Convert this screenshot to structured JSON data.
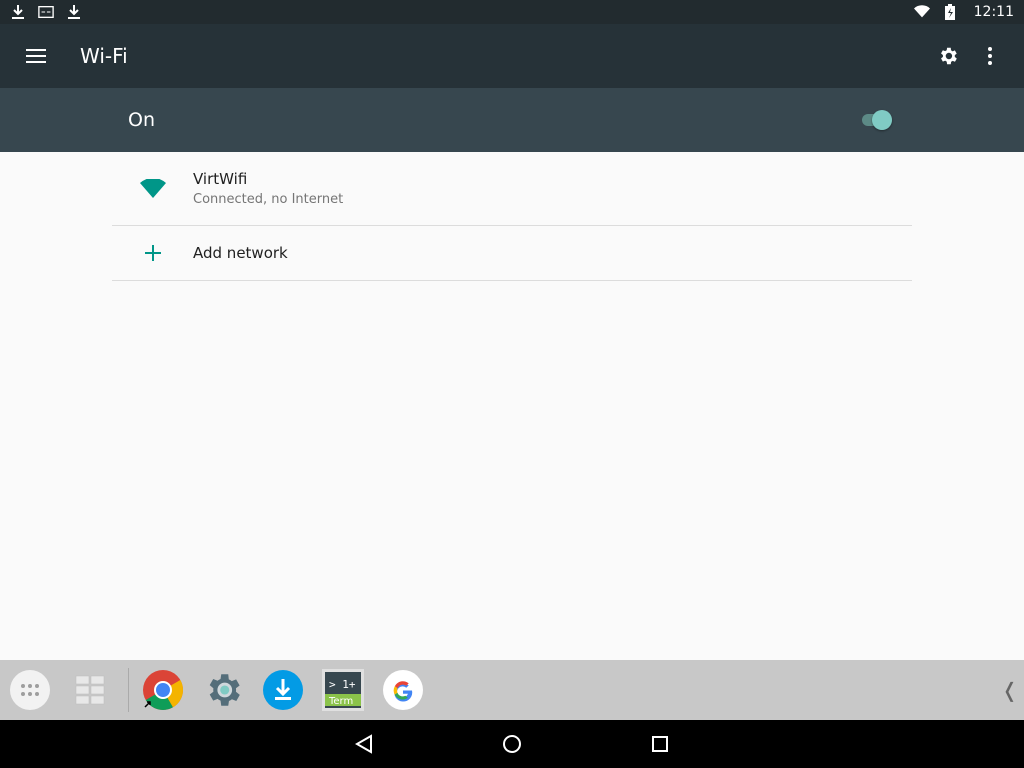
{
  "status_bar": {
    "time": "12:11",
    "left_icons": [
      "download-icon",
      "sim-icon",
      "download-icon"
    ],
    "right_icons": [
      "wifi-icon",
      "battery-icon"
    ]
  },
  "toolbar": {
    "title": "Wi-Fi",
    "icons": [
      "menu-icon",
      "settings-icon",
      "more-vert-icon"
    ]
  },
  "switch_bar": {
    "label": "On",
    "checked": true
  },
  "networks": [
    {
      "name": "VirtWifi",
      "status": "Connected, no Internet",
      "icon": "wifi-signal-icon"
    }
  ],
  "add_network": {
    "label": "Add network",
    "icon": "plus-icon"
  },
  "taskbar": {
    "apps": [
      {
        "name": "all-apps",
        "icon": "app-drawer-icon"
      },
      {
        "name": "recents-grid",
        "icon": "grid-icon"
      },
      {
        "name": "chrome",
        "icon": "chrome-icon"
      },
      {
        "name": "settings",
        "icon": "settings-app-icon"
      },
      {
        "name": "downloads",
        "icon": "downloads-app-icon"
      },
      {
        "name": "terminal",
        "icon": "terminal-app-icon",
        "label_line1": "> 1+",
        "label_line2": "Term"
      },
      {
        "name": "google",
        "icon": "google-app-icon",
        "label": "G"
      }
    ],
    "collapse_glyph": "❬"
  },
  "navbar": {
    "icons": [
      "back-icon",
      "home-icon",
      "recents-icon"
    ]
  },
  "colors": {
    "accent": "#009688",
    "toolbar": "#263238",
    "switch_bar": "#37474f"
  }
}
